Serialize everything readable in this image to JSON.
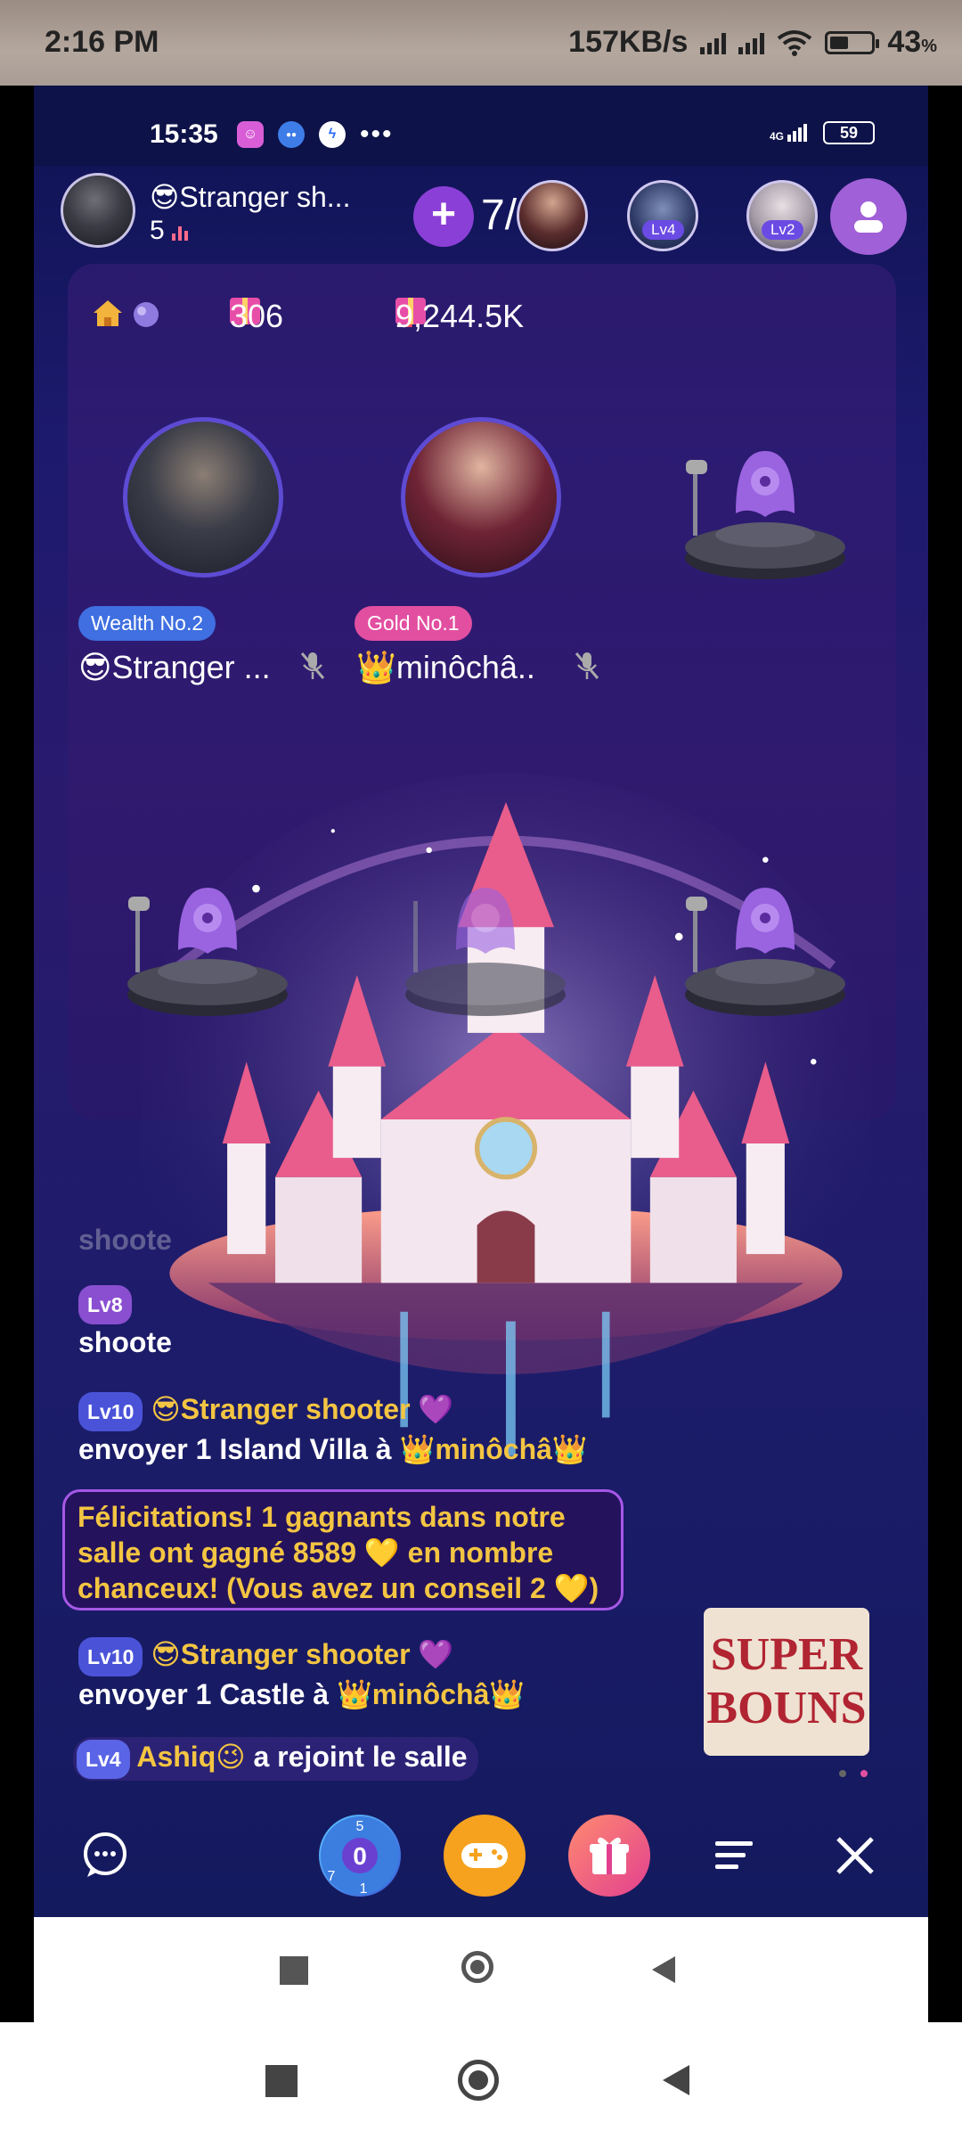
{
  "outer_status": {
    "time": "2:16 PM",
    "speed": "157KB/s",
    "battery": "43",
    "battery_unit": "%"
  },
  "inner_status": {
    "time": "15:35",
    "net": "4G",
    "battery": "59"
  },
  "header": {
    "host_name": "😎Stranger sh...",
    "host_count": "5",
    "viewer_count": "7/9",
    "viewer_levels": [
      "Lv4",
      "Lv2"
    ]
  },
  "stats": {
    "level": "306",
    "rank": "2",
    "total": "9,244.5K"
  },
  "seats": [
    {
      "badge": "Wealth No.2",
      "name": "😎Stranger ..."
    },
    {
      "badge": "Gold No.1",
      "name": "👑minôchâ.."
    }
  ],
  "chat": {
    "faded": "shoote",
    "lv8_badge": "Lv8",
    "line1_name": "shoote",
    "line2_badge": "Lv10",
    "line2_user": "😎Stranger shooter 💜",
    "line2_text_a": "envoyer 1 Island Villa à ",
    "line2_text_b": "👑minôchâ👑",
    "congrats": "Félicitations! 1 gagnants dans notre salle ont gagné 8589 💛 en nombre chanceux! (Vous avez un conseil 2 💛)",
    "line3_badge": "Lv10",
    "line3_user": "😎Stranger shooter 💜",
    "line3_text_a": "envoyer 1 Castle à ",
    "line3_text_b": "👑minôchâ👑",
    "line4_badge": "Lv4",
    "line4_user": "Ashiq😉",
    "line4_text": " a rejoint le salle"
  },
  "super_bonus": {
    "line1": "SUPER",
    "line2": "BOUNS"
  },
  "game_numbers": {
    "top": "5",
    "center": "0",
    "left": "7",
    "bottom": "1"
  },
  "colors": {
    "accent_purple": "#8a3fd6",
    "gold": "#f4c542",
    "badge_blue": "#3f6fe0",
    "badge_pink": "#e24fa0"
  }
}
